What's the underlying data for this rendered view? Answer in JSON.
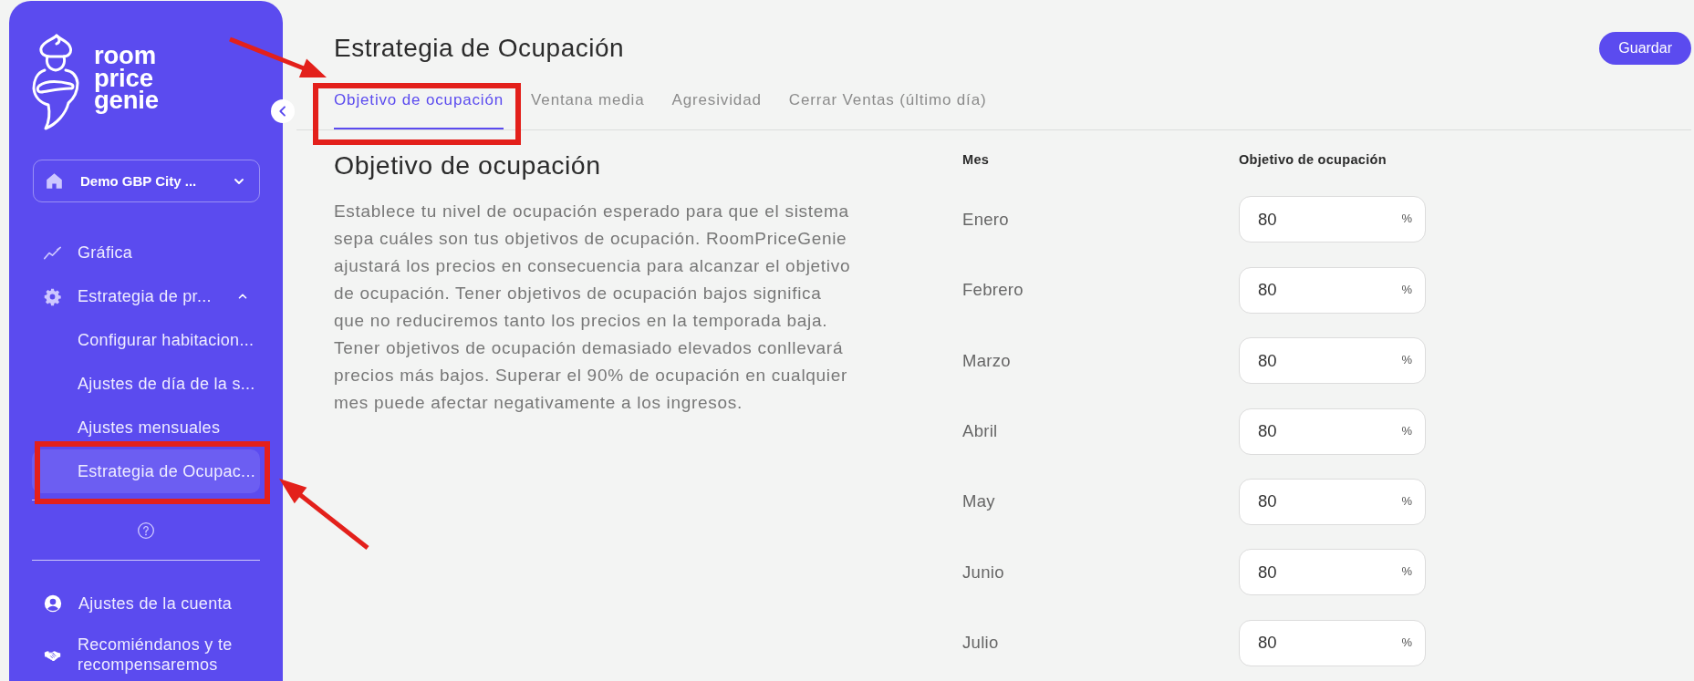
{
  "sidebar": {
    "wordmark": "room price genie",
    "property_selector": {
      "label": "Demo GBP City ..."
    },
    "nav": [
      {
        "label": "Gráfica",
        "selected": false
      },
      {
        "label": "Estrategia de pr...",
        "selected": false,
        "expanded": true,
        "children": [
          {
            "label": "Configurar habitacion...",
            "selected": false
          },
          {
            "label": "Ajustes de día de la s...",
            "selected": false
          },
          {
            "label": "Ajustes mensuales",
            "selected": false
          },
          {
            "label": "Estrategia de Ocupac...",
            "selected": true
          }
        ]
      }
    ],
    "footer_links": [
      {
        "label": "Ajustes de la cuenta"
      },
      {
        "label": "Recomiéndanos y te recompensaremos"
      }
    ]
  },
  "header": {
    "title": "Estrategia de Ocupación",
    "save_button": "Guardar"
  },
  "tabs": [
    {
      "label": "Objetivo de ocupación",
      "selected": true
    },
    {
      "label": "Ventana media",
      "selected": false
    },
    {
      "label": "Agresividad",
      "selected": false
    },
    {
      "label": "Cerrar Ventas (último día)",
      "selected": false
    }
  ],
  "section": {
    "heading": "Objetivo de ocupación",
    "description": "Establece tu nivel de ocupación esperado para que el sistema sepa cuáles son tus objetivos de ocupación. RoomPriceGenie ajustará los precios en consecuencia para alcanzar el objetivo de ocupación. Tener objetivos de ocupación bajos significa que no reduciremos tanto los precios en la temporada baja. Tener objetivos de ocupación demasiado elevados conllevará precios más bajos. Superar el 90% de ocupación en cualquier mes puede afectar negativamente a los ingresos."
  },
  "table": {
    "columns": [
      "Mes",
      "Objetivo de ocupación"
    ],
    "rows": [
      {
        "month": "Enero",
        "value": "80",
        "unit": "%"
      },
      {
        "month": "Febrero",
        "value": "80",
        "unit": "%"
      },
      {
        "month": "Marzo",
        "value": "80",
        "unit": "%"
      },
      {
        "month": "Abril",
        "value": "80",
        "unit": "%"
      },
      {
        "month": "May",
        "value": "80",
        "unit": "%"
      },
      {
        "month": "Junio",
        "value": "80",
        "unit": "%"
      },
      {
        "month": "Julio",
        "value": "80",
        "unit": "%"
      }
    ]
  }
}
